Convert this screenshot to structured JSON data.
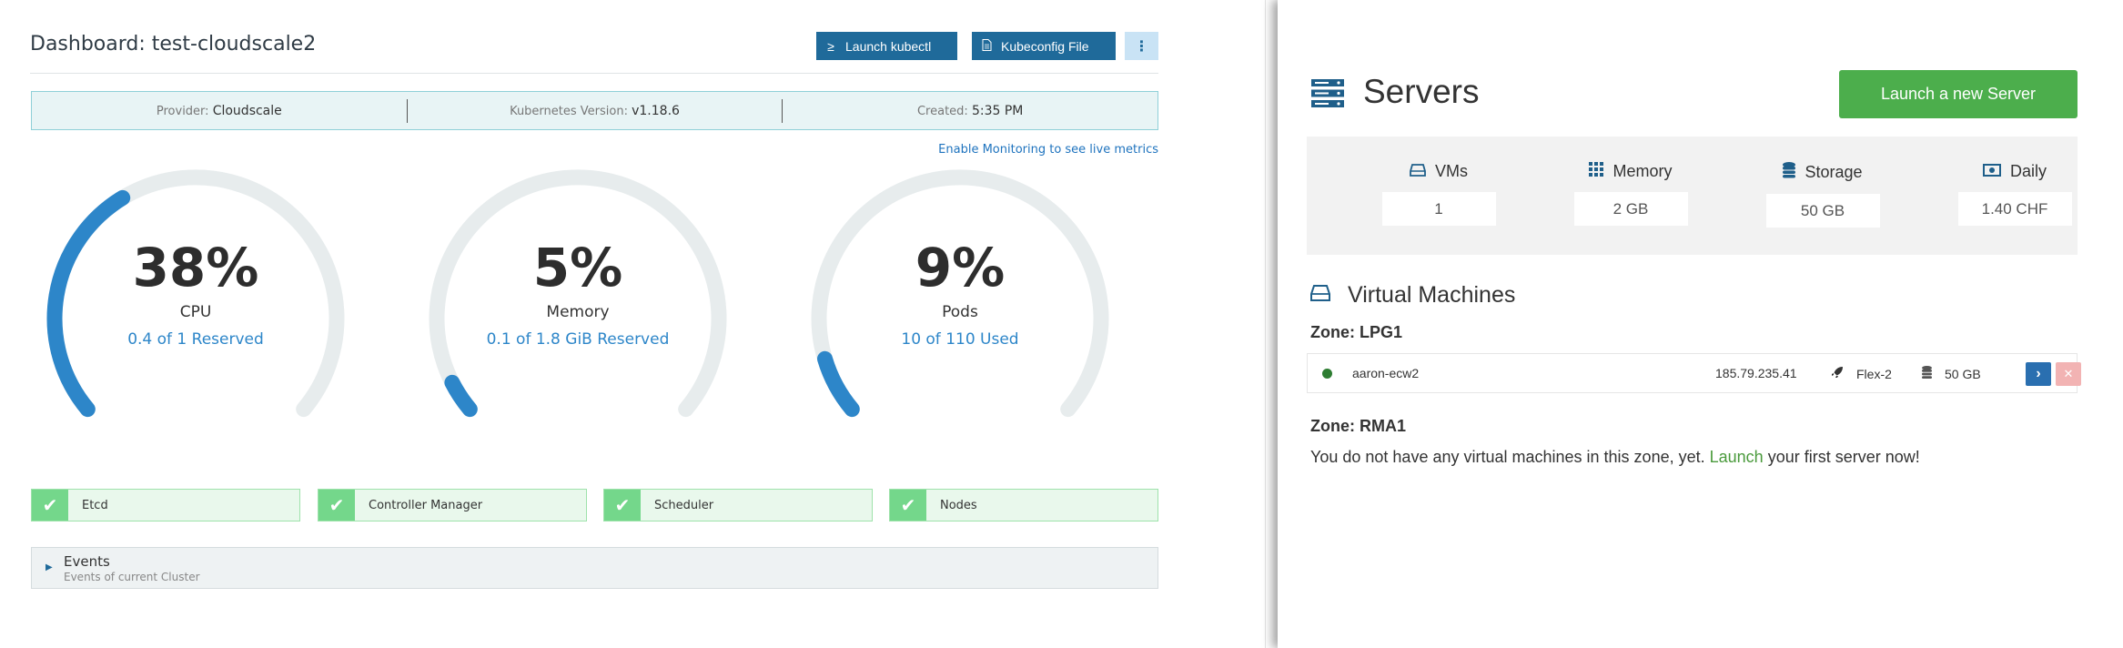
{
  "dashboard": {
    "title": "Dashboard: test-cloudscale2",
    "buttons": {
      "kubectl_label": "Launch kubectl",
      "kubectl_icon": "terminal-icon",
      "kubeconfig_label": "Kubeconfig File",
      "kubeconfig_icon": "file-icon",
      "more_icon": "kebab-icon"
    },
    "info": {
      "provider_label": "Provider:",
      "provider_value": "Cloudscale",
      "k8s_label": "Kubernetes Version:",
      "k8s_value": "v1.18.6",
      "created_label": "Created:",
      "created_value": "5:35 PM"
    },
    "monitoring_link": "Enable Monitoring to see live metrics",
    "gauges": [
      {
        "percent_text": "38%",
        "name": "CPU",
        "sub": "0.4 of 1 Reserved",
        "fraction": 0.38
      },
      {
        "percent_text": "5%",
        "name": "Memory",
        "sub": "0.1 of 1.8 GiB Reserved",
        "fraction": 0.05
      },
      {
        "percent_text": "9%",
        "name": "Pods",
        "sub": "10 of 110 Used",
        "fraction": 0.09
      }
    ],
    "statuses": [
      {
        "label": "Etcd"
      },
      {
        "label": "Controller Manager"
      },
      {
        "label": "Scheduler"
      },
      {
        "label": "Nodes"
      }
    ],
    "events": {
      "title": "Events",
      "subtitle": "Events of current Cluster"
    },
    "colors": {
      "gauge_fill": "#2d86c9",
      "gauge_track": "#e7eced",
      "ok_green": "#74d78b"
    }
  },
  "servers": {
    "title": "Servers",
    "launch_button": "Launch a new Server",
    "summary": [
      {
        "label": "VMs",
        "value": "1",
        "icon": "disk-drive-icon"
      },
      {
        "label": "Memory",
        "value": "2 GB",
        "icon": "grid-icon"
      },
      {
        "label": "Storage",
        "value": "50 GB",
        "icon": "database-icon"
      },
      {
        "label": "Daily",
        "value": "1.40 CHF",
        "icon": "money-icon"
      }
    ],
    "vm_section_title": "Virtual Machines",
    "zones": [
      {
        "name": "Zone: LPG1"
      },
      {
        "name": "Zone: RMA1"
      }
    ],
    "vm": {
      "name": "aaron-ecw2",
      "ip": "185.79.235.41",
      "flavor": "Flex-2",
      "disk": "50 GB",
      "status_color": "#2e7d32"
    },
    "empty_msg_prefix": "You do not have any virtual machines in this zone, yet.",
    "empty_msg_link": "Launch",
    "empty_msg_suffix": "your first server now!"
  }
}
